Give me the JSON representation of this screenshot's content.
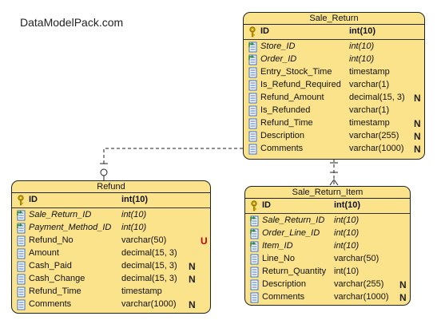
{
  "watermark": "DataModelPack.com",
  "entities": [
    {
      "key": "sale_return",
      "title": "Sale_Return",
      "columns": [
        {
          "name": "ID",
          "type": "int(10)",
          "kind": "pk",
          "badge": ""
        },
        {
          "name": "Store_ID",
          "type": "int(10)",
          "kind": "fk",
          "badge": ""
        },
        {
          "name": "Order_ID",
          "type": "int(10)",
          "kind": "fk",
          "badge": ""
        },
        {
          "name": "Entry_Stock_Time",
          "type": "timestamp",
          "kind": "col",
          "badge": ""
        },
        {
          "name": "Is_Refund_Required",
          "type": "varchar(1)",
          "kind": "col",
          "badge": ""
        },
        {
          "name": "Refund_Amount",
          "type": "decimal(15, 3)",
          "kind": "col",
          "badge": "N"
        },
        {
          "name": "Is_Refunded",
          "type": "varchar(1)",
          "kind": "col",
          "badge": ""
        },
        {
          "name": "Refund_Time",
          "type": "timestamp",
          "kind": "col",
          "badge": "N"
        },
        {
          "name": "Description",
          "type": "varchar(255)",
          "kind": "col",
          "badge": "N"
        },
        {
          "name": "Comments",
          "type": "varchar(1000)",
          "kind": "col",
          "badge": "N"
        }
      ]
    },
    {
      "key": "refund",
      "title": "Refund",
      "columns": [
        {
          "name": "ID",
          "type": "int(10)",
          "kind": "pk",
          "badge": ""
        },
        {
          "name": "Sale_Return_ID",
          "type": "int(10)",
          "kind": "fk",
          "badge": ""
        },
        {
          "name": "Payment_Method_ID",
          "type": "int(10)",
          "kind": "fk",
          "badge": ""
        },
        {
          "name": "Refund_No",
          "type": "varchar(50)",
          "kind": "col",
          "badge": "U"
        },
        {
          "name": "Amount",
          "type": "decimal(15, 3)",
          "kind": "col",
          "badge": ""
        },
        {
          "name": "Cash_Paid",
          "type": "decimal(15, 3)",
          "kind": "col",
          "badge": "N"
        },
        {
          "name": "Cash_Change",
          "type": "decimal(15, 3)",
          "kind": "col",
          "badge": "N"
        },
        {
          "name": "Refund_Time",
          "type": "timestamp",
          "kind": "col",
          "badge": ""
        },
        {
          "name": "Comments",
          "type": "varchar(1000)",
          "kind": "col",
          "badge": "N"
        }
      ]
    },
    {
      "key": "sale_return_item",
      "title": "Sale_Return_Item",
      "columns": [
        {
          "name": "ID",
          "type": "int(10)",
          "kind": "pk",
          "badge": ""
        },
        {
          "name": "Sale_Return_ID",
          "type": "int(10)",
          "kind": "fk",
          "badge": ""
        },
        {
          "name": "Order_Line_ID",
          "type": "int(10)",
          "kind": "fk",
          "badge": ""
        },
        {
          "name": "Item_ID",
          "type": "int(10)",
          "kind": "fk",
          "badge": ""
        },
        {
          "name": "Line_No",
          "type": "varchar(50)",
          "kind": "col",
          "badge": ""
        },
        {
          "name": "Return_Quantity",
          "type": "int(10)",
          "kind": "col",
          "badge": ""
        },
        {
          "name": "Description",
          "type": "varchar(255)",
          "kind": "col",
          "badge": "N"
        },
        {
          "name": "Comments",
          "type": "varchar(1000)",
          "kind": "col",
          "badge": "N"
        }
      ]
    }
  ],
  "relationships": [
    {
      "from": "sale_return",
      "to": "refund",
      "style": "dashed",
      "to_end": "zero-or-one"
    },
    {
      "from": "sale_return",
      "to": "sale_return_item",
      "style": "dashed",
      "to_end": "zero-or-many"
    }
  ],
  "colors": {
    "entity_fill": "#fbe38c",
    "border": "#222222",
    "unique_badge": "#c00000",
    "key_icon": "#c8a000",
    "fk_arrow": "#2e8b3a",
    "column_icon": "#3a6fc4"
  }
}
